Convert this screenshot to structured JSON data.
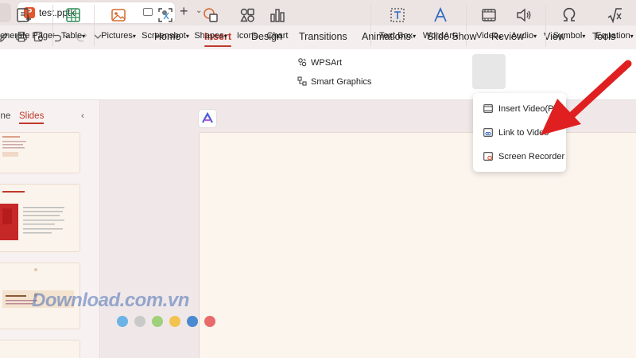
{
  "titlebar": {
    "app_badge": "P",
    "doc_title": "test.pptx",
    "new_tab": "+",
    "tab_menu": "⌄"
  },
  "menu": {
    "tabs": [
      "Home",
      "Insert",
      "Design",
      "Transitions",
      "Animations",
      "Slide Show",
      "Review",
      "View",
      "Tools"
    ],
    "active": "Insert"
  },
  "ribbon": {
    "generate_page": "enerate Page",
    "table": "Table",
    "pictures": "Pictures",
    "screenshot": "Screenshot",
    "shapes": "Shapes",
    "icons": "Icons",
    "chart": "Chart",
    "wpsart": "WPSArt",
    "smart_graphics": "Smart Graphics",
    "text_box": "Text Box",
    "wordart": "WordArt",
    "video": "Video",
    "audio": "Audio",
    "symbol": "Symbol",
    "equation": "Equation",
    "dropdown_caret": "▾",
    "video_caret": "▴"
  },
  "left_panel": {
    "tab_outline": "ine",
    "tab_slides": "Slides",
    "collapse": "‹"
  },
  "video_menu": {
    "items": [
      "Insert Video(P)",
      "Link to Video",
      "Screen Recorder"
    ]
  },
  "watermark": {
    "text": "Download.com.vn",
    "dot_colors": [
      "#6bb3e6",
      "#c9c9c9",
      "#9fd07a",
      "#f2c34e",
      "#4a8ad0",
      "#e86a6a"
    ]
  },
  "colors": {
    "accent": "#c0392b",
    "arrow": "#e02020"
  }
}
